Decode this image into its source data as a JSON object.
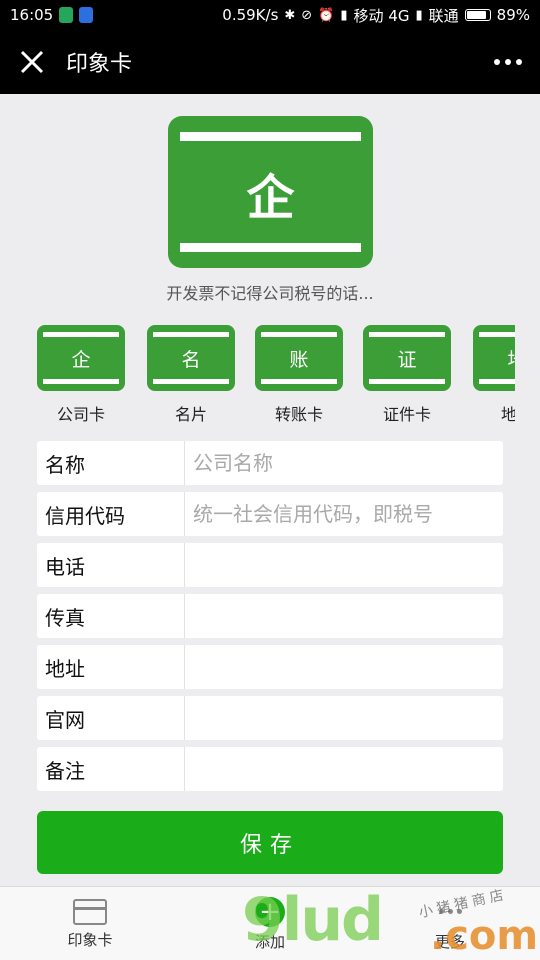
{
  "status_bar": {
    "time": "16:05",
    "speed": "0.59K/s",
    "carrier1": "移动 4G",
    "carrier2": "联通",
    "battery": "89%",
    "battery_level": 0.89,
    "badge_colors": [
      "#26a65b",
      "#2d6fe0"
    ]
  },
  "title_bar": {
    "title": "印象卡",
    "close_icon": "close-icon",
    "more_icon": "more-dots-icon"
  },
  "hero": {
    "glyph": "企",
    "hint": "开发票不记得公司税号的话...",
    "color": "#3b9e37"
  },
  "card_types": [
    {
      "glyph": "企",
      "label": "公司卡"
    },
    {
      "glyph": "名",
      "label": "名片"
    },
    {
      "glyph": "账",
      "label": "转账卡"
    },
    {
      "glyph": "证",
      "label": "证件卡"
    },
    {
      "glyph": "地",
      "label": "地址"
    }
  ],
  "form": {
    "fields": [
      {
        "label": "名称",
        "value": "",
        "placeholder": "公司名称"
      },
      {
        "label": "信用代码",
        "value": "",
        "placeholder": "统一社会信用代码，即税号"
      },
      {
        "label": "电话",
        "value": "",
        "placeholder": ""
      },
      {
        "label": "传真",
        "value": "",
        "placeholder": ""
      },
      {
        "label": "地址",
        "value": "",
        "placeholder": ""
      },
      {
        "label": "官网",
        "value": "",
        "placeholder": ""
      },
      {
        "label": "备注",
        "value": "",
        "placeholder": ""
      }
    ]
  },
  "save_label": "保存",
  "save_color": "#1aad19",
  "tabs": [
    {
      "label": "印象卡",
      "icon": "card-icon"
    },
    {
      "label": "添加",
      "icon": "add-icon"
    },
    {
      "label": "更多",
      "icon": "more-icon"
    }
  ],
  "watermark": {
    "main": "9lud",
    "com": ".com",
    "shop": "小猪猪商店"
  }
}
